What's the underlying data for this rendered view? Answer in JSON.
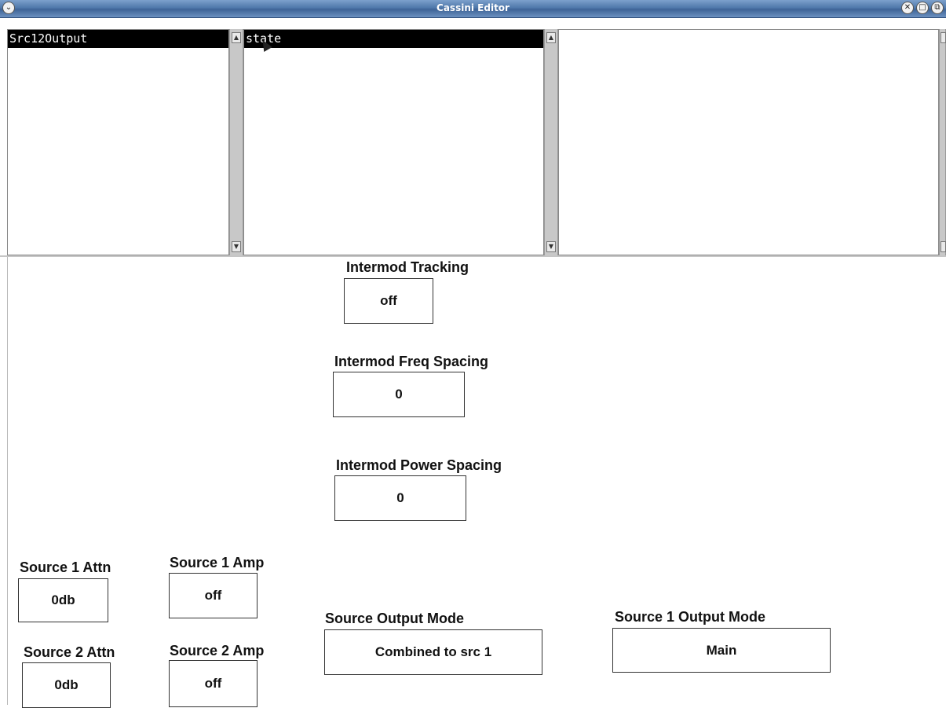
{
  "window": {
    "title": "Cassini Editor",
    "controls": [
      "menu-icon",
      "close-icon",
      "maximize-icon",
      "restore-icon"
    ]
  },
  "lists": {
    "left": {
      "selected": "Src12Output"
    },
    "middle": {
      "selected": "state"
    },
    "right": {
      "selected": ""
    }
  },
  "fields": {
    "intermod_tracking": {
      "label": "Intermod Tracking",
      "value": "off"
    },
    "intermod_freq_spacing": {
      "label": "Intermod Freq Spacing",
      "value": "0"
    },
    "intermod_power_spacing": {
      "label": "Intermod Power Spacing",
      "value": "0"
    },
    "source1_attn": {
      "label": "Source 1 Attn",
      "value": "0db"
    },
    "source1_amp": {
      "label": "Source 1 Amp",
      "value": "off"
    },
    "source2_attn": {
      "label": "Source 2 Attn",
      "value": "0db"
    },
    "source2_amp": {
      "label": "Source 2 Amp",
      "value": "off"
    },
    "source_output_mode": {
      "label": "Source Output Mode",
      "value": "Combined to src 1"
    },
    "source1_output_mode": {
      "label": "Source 1 Output Mode",
      "value": "Main"
    }
  },
  "colors": {
    "titlebar": "#4f78aa",
    "selection": "#000000"
  }
}
